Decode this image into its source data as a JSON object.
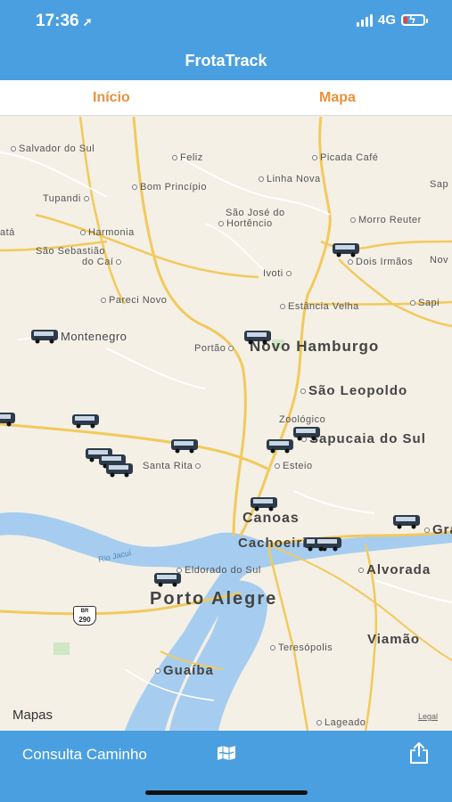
{
  "status": {
    "time": "17:36",
    "network": "4G"
  },
  "nav": {
    "title": "FrotaTrack"
  },
  "tabs": [
    {
      "label": "Início"
    },
    {
      "label": "Mapa"
    }
  ],
  "map": {
    "places": [
      {
        "label": "Salvador do Sul"
      },
      {
        "label": "Feliz"
      },
      {
        "label": "Picada Café"
      },
      {
        "label": "Sap"
      },
      {
        "label": "Tupandi"
      },
      {
        "label": "Bom Princípio"
      },
      {
        "label": "Linha Nova"
      },
      {
        "label": "São José do"
      },
      {
        "label": "Hortêncio"
      },
      {
        "label": "Morro Reuter"
      },
      {
        "label": "Harmonia"
      },
      {
        "label": "atá"
      },
      {
        "label": "São Sebastião"
      },
      {
        "label": "do Caí"
      },
      {
        "label": "Ivoti"
      },
      {
        "label": "Dois Irmãos"
      },
      {
        "label": "Nov"
      },
      {
        "label": "Pareci Novo"
      },
      {
        "label": "Estância Velha"
      },
      {
        "label": "Sapi"
      },
      {
        "label": "Montenegro"
      },
      {
        "label": "Portão"
      },
      {
        "label": "Zoológico"
      },
      {
        "label": "Esteio"
      },
      {
        "label": "Santa Rita"
      },
      {
        "label": "Rio Jacuí"
      },
      {
        "label": "Eldorado do Sul"
      },
      {
        "label": "Teresópolis"
      },
      {
        "label": "Lageado"
      }
    ],
    "cities": [
      {
        "label": "Novo Hamburgo"
      },
      {
        "label": "São Leopoldo"
      },
      {
        "label": "Sapucaia do Sul"
      },
      {
        "label": "Canoas"
      },
      {
        "label": "Cachoeirinha"
      },
      {
        "label": "Alvorada"
      },
      {
        "label": "Viamão"
      },
      {
        "label": "Guaíba"
      },
      {
        "label": "Gra"
      }
    ],
    "big_city": "Porto Alegre",
    "shield": {
      "top": "BR",
      "number": "290"
    },
    "attribution": "Mapas",
    "legal": "Legal"
  },
  "toolbar": {
    "route_button": "Consulta Caminho"
  },
  "colors": {
    "bar": "#4a9fe0",
    "tab_text": "#e8913a",
    "road": "#f2c95c",
    "water": "#9cc8ec"
  },
  "icons": [
    "location-arrow-icon",
    "signal-icon",
    "battery-charging-icon",
    "bus-icon",
    "map-icon",
    "share-icon",
    "apple-logo-icon"
  ]
}
